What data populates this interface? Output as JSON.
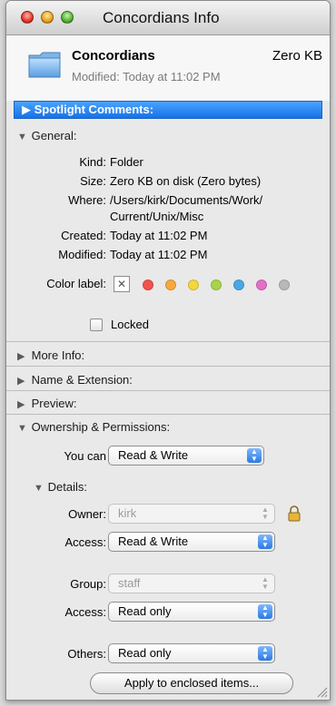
{
  "window": {
    "title": "Concordians Info"
  },
  "header": {
    "name": "Concordians",
    "size": "Zero KB",
    "modified": "Modified: Today at 11:02 PM"
  },
  "spotlight": {
    "label": "Spotlight Comments:"
  },
  "general": {
    "label": "General:",
    "rows": [
      {
        "k": "Kind:",
        "v": "Folder"
      },
      {
        "k": "Size:",
        "v": "Zero KB on disk (Zero bytes)"
      },
      {
        "k": "Where:",
        "v": "/Users/kirk/Documents/Work/"
      },
      {
        "k": "",
        "v": "Current/Unix/Misc"
      },
      {
        "k": "Created:",
        "v": "Today at 11:02 PM"
      },
      {
        "k": "Modified:",
        "v": "Today at 11:02 PM"
      }
    ],
    "color_label": "Color label:",
    "color_none": "✕",
    "colors": [
      "#f2514e",
      "#f7a93c",
      "#f4d63f",
      "#a8d44a",
      "#4aa7e6",
      "#e36fc9",
      "#b8b8b8"
    ],
    "locked_label": "Locked"
  },
  "sections": {
    "more_info": "More Info:",
    "name_ext": "Name & Extension:",
    "preview": "Preview:",
    "ownership": "Ownership & Permissions:"
  },
  "ownership": {
    "you_can_label": "You can",
    "you_can_value": "Read & Write",
    "details_label": "Details:",
    "owner_label": "Owner:",
    "owner_value": "kirk",
    "owner_access_label": "Access:",
    "owner_access_value": "Read & Write",
    "group_label": "Group:",
    "group_value": "staff",
    "group_access_label": "Access:",
    "group_access_value": "Read only",
    "others_label": "Others:",
    "others_value": "Read only",
    "apply_label": "Apply to enclosed items..."
  }
}
